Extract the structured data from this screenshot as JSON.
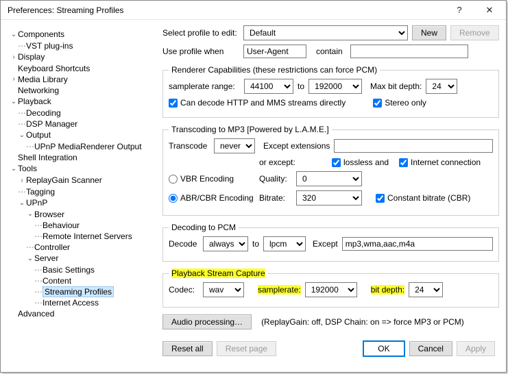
{
  "title": "Preferences: Streaming Profiles",
  "title_icons": {
    "help": "?",
    "close": "✕"
  },
  "tree": {
    "components": "Components",
    "vst": "VST plug-ins",
    "display": "Display",
    "kbs": "Keyboard Shortcuts",
    "medialib": "Media Library",
    "networking": "Networking",
    "playback": "Playback",
    "decoding": "Decoding",
    "dsp": "DSP Manager",
    "output": "Output",
    "upnp_out": "UPnP MediaRenderer Output",
    "shellint": "Shell Integration",
    "tools": "Tools",
    "rgscan": "ReplayGain Scanner",
    "tagging": "Tagging",
    "upnp": "UPnP",
    "browser": "Browser",
    "behaviour": "Behaviour",
    "remote_servers": "Remote Internet Servers",
    "controller": "Controller",
    "server": "Server",
    "basic": "Basic Settings",
    "content": "Content",
    "streaming": "Streaming Profiles",
    "internet": "Internet Access",
    "advanced": "Advanced"
  },
  "profile": {
    "select_label": "Select profile to edit:",
    "select_value": "Default",
    "new": "New",
    "remove": "Remove",
    "use_label": "Use profile when",
    "use_field": "User-Agent",
    "contain": "contain",
    "contain_value": ""
  },
  "renderer": {
    "legend": "Renderer Capabilities (these restrictions can force PCM)",
    "sr_label": "samplerate range:",
    "sr_from": "44100",
    "to": "to",
    "sr_to": "192000",
    "maxbit_label": "Max bit depth:",
    "maxbit": "24",
    "can_decode": "Can decode  HTTP and MMS  streams directly",
    "stereo": "Stereo only"
  },
  "mp3": {
    "legend": "Transcoding to MP3  [Powered by L.A.M.E.]",
    "transcode_label": "Transcode",
    "transcode": "never",
    "except_ext": "Except extensions",
    "except_ext_val": "",
    "or_except": "or except:",
    "lossless": "lossless and",
    "internet": "Internet connection",
    "vbr": "VBR Encoding",
    "abr": "ABR/CBR Encoding",
    "quality_label": "Quality:",
    "quality": "0",
    "bitrate_label": "Bitrate:",
    "bitrate": "320",
    "cbr": "Constant bitrate (CBR)"
  },
  "pcm": {
    "legend": "Decoding to PCM",
    "decode_label": "Decode",
    "decode": "always",
    "to": "to",
    "fmt": "lpcm",
    "except_label": "Except",
    "except": "mp3,wma,aac,m4a"
  },
  "capture": {
    "legend": "Playback Stream Capture",
    "codec_label": "Codec:",
    "codec": "wav",
    "sr_label": "samplerate:",
    "sr": "192000",
    "bd_label": "bit depth:",
    "bd": "24"
  },
  "audio_proc": {
    "btn": "Audio processing…",
    "info": "(ReplayGain: off, DSP Chain: on => force MP3 or PCM)"
  },
  "footer": {
    "reset_all": "Reset all",
    "reset_page": "Reset page",
    "ok": "OK",
    "cancel": "Cancel",
    "apply": "Apply"
  }
}
